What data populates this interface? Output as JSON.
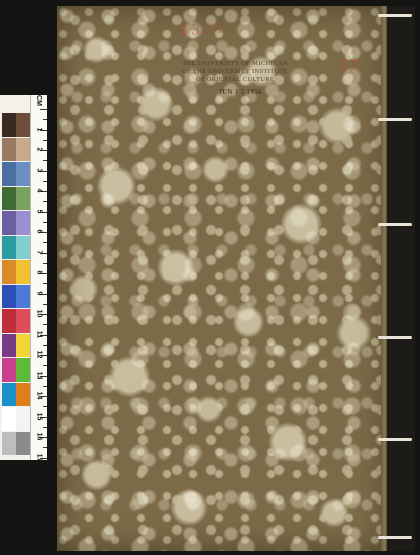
{
  "stamp": {
    "institution": "THE UNIVERSITY OF MICHIGAN\nOF THE UNIVERSITY INSTITUTE\nOF ORIENTAL CULTURE",
    "date": "JUN 1 5 1956"
  },
  "handwriting": {
    "red_note": "4 3 2 1",
    "red_mark": "17"
  },
  "calibration_target": {
    "unit": "CM",
    "ruler_numbers": [
      "1",
      "2",
      "3",
      "4",
      "5",
      "6",
      "7",
      "8",
      "9",
      "10",
      "11",
      "12",
      "13",
      "14",
      "15",
      "16",
      "17"
    ],
    "colors": {
      "row1": [
        "#3b2a22",
        "#6e4d3a"
      ],
      "row2": [
        "#9a7a63",
        "#c9a98e"
      ],
      "row3": [
        "#4b6fa1",
        "#6a8fc0"
      ],
      "row4": [
        "#3f6b34",
        "#7ba15e"
      ],
      "row5": [
        "#6b5fa3",
        "#9a8fd0"
      ],
      "row6": [
        "#2d9ca0",
        "#7fd0cc"
      ],
      "row7": [
        "#d98a2b",
        "#f2c033"
      ],
      "row8": [
        "#2b4fb5",
        "#4c78d8"
      ],
      "row9": [
        "#c02e3c",
        "#e04d5a"
      ],
      "row10": [
        "#7a3a8a",
        "#f0d63a"
      ],
      "row11": [
        "#c83f8f",
        "#5dbb3a"
      ],
      "row12": [
        "#1b8fc8",
        "#e07e1c"
      ],
      "row13": [
        "#ffffff",
        "#f3f3f3"
      ],
      "row14": [
        "#bdbdbd",
        "#8a8a8a"
      ]
    }
  },
  "colors": {
    "cover_base": "#7c6b48",
    "cover_spot": "#c7bc9d",
    "stitch": "#e9e4d6",
    "background": "#0f0f0d"
  }
}
